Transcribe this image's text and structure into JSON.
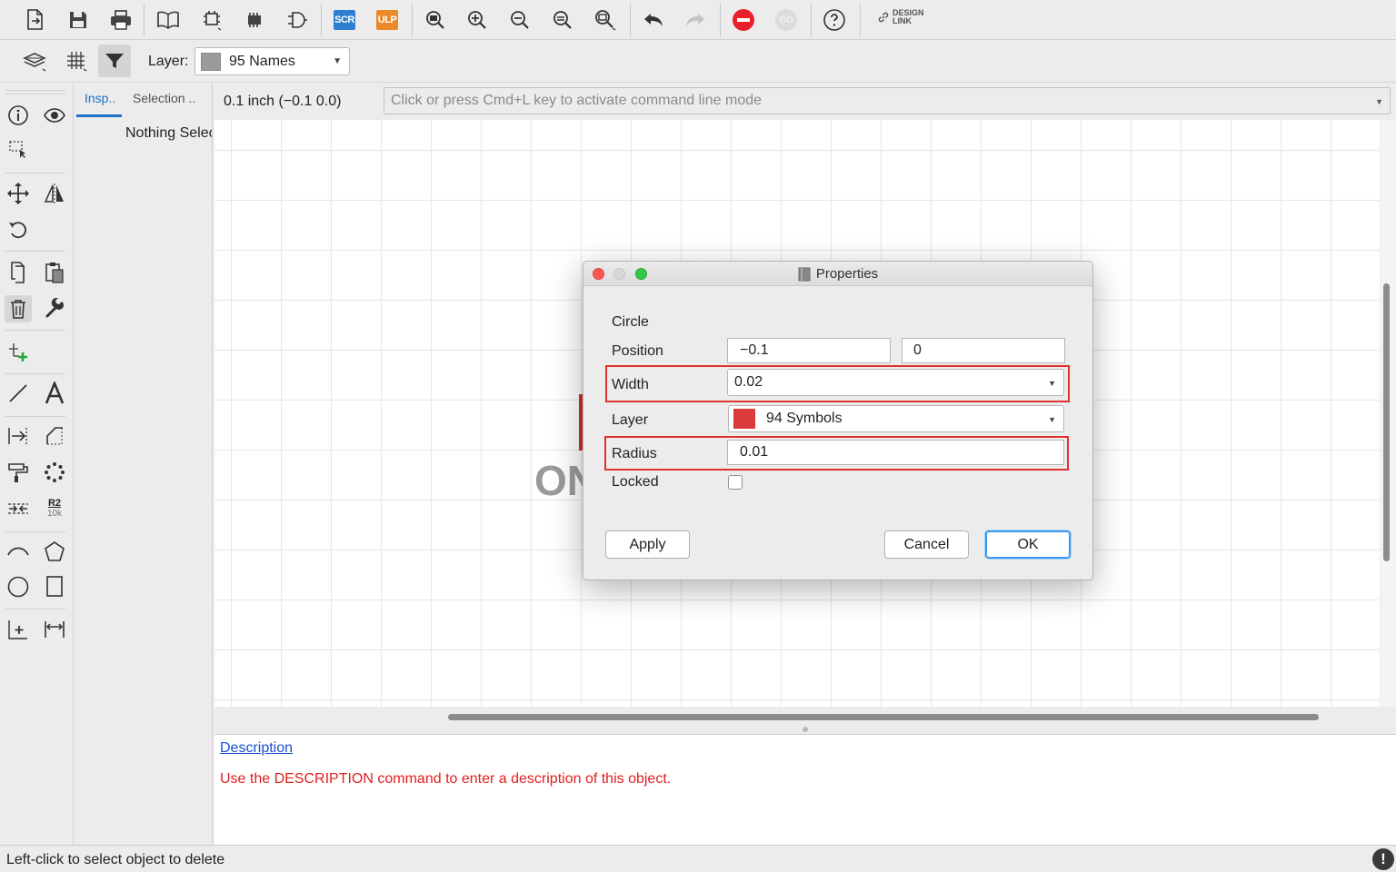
{
  "toolbar": {
    "badges": {
      "script": "SCR",
      "ulp": "ULP",
      "go": "GO"
    },
    "design_link": {
      "line1": "DESIGN",
      "line2": "LINK"
    },
    "colors": {
      "script_badge": "#2f7fd0",
      "ulp_badge": "#e98a2a",
      "stop": "#e8202a"
    }
  },
  "layer_bar": {
    "label": "Layer:",
    "selected_layer": "95 Names",
    "swatch_color": "#9a9a9a"
  },
  "left_tools": {
    "value_badge": {
      "name": "R2",
      "value": "10k"
    }
  },
  "inspector": {
    "tabs": [
      "Insp..",
      "Selection .."
    ],
    "active_tab": 0,
    "empty_message": "Nothing Selected"
  },
  "command": {
    "coordinates": "0.1 inch (−0.1 0.0)",
    "placeholder": "Click or press Cmd+L key to activate command line mode"
  },
  "canvas": {
    "partial_text": "ON"
  },
  "description": {
    "link": "Description",
    "hint": "Use the DESCRIPTION command to enter a description of this object."
  },
  "status": {
    "message": "Left-click to select object to delete",
    "alert": "!"
  },
  "dialog": {
    "title": "Properties",
    "object_type": "Circle",
    "fields": {
      "position_label": "Position",
      "position_x": "−0.1",
      "position_y": "0",
      "width_label": "Width",
      "width_value": "0.02",
      "layer_label": "Layer",
      "layer_value": "94 Symbols",
      "layer_color": "#d93a3a",
      "radius_label": "Radius",
      "radius_value": "0.01",
      "locked_label": "Locked",
      "locked": false
    },
    "buttons": {
      "apply": "Apply",
      "cancel": "Cancel",
      "ok": "OK"
    },
    "highlight_color": "#e03131"
  }
}
